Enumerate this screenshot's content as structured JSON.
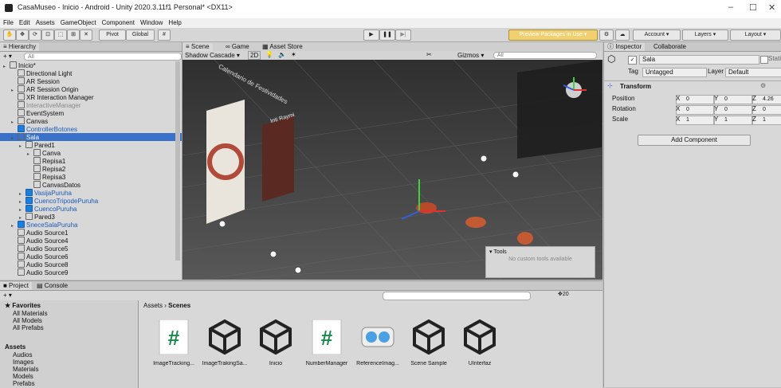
{
  "window": {
    "title": "CasaMuseo - Inicio - Android - Unity 2020.3.11f1 Personal* <DX11>",
    "min": "–",
    "max": "☐",
    "close": "✕"
  },
  "menu": [
    "File",
    "Edit",
    "Assets",
    "GameObject",
    "Component",
    "Window",
    "Help"
  ],
  "toolbar": {
    "pivot": "Pivot",
    "global": "Global",
    "preview": "Preview Packages in Use ▾",
    "account": "Account ▾",
    "layers": "Layers ▾",
    "layout": "Layout ▾"
  },
  "hierarchy": {
    "tab": "≡ Hierarchy",
    "search_placeholder": "All",
    "add": "+ ▾",
    "rows": [
      {
        "label": "Inicio*",
        "indent": 0
      },
      {
        "label": "Directional Light",
        "indent": 1
      },
      {
        "label": "AR Session",
        "indent": 1
      },
      {
        "label": "AR Session Origin",
        "indent": 1
      },
      {
        "label": "XR Interaction Manager",
        "indent": 1
      },
      {
        "label": "InteractiveManager",
        "indent": 1
      },
      {
        "label": "EventSystem",
        "indent": 1
      },
      {
        "label": "Canvas",
        "indent": 1
      },
      {
        "label": "ControllerBotones",
        "indent": 1
      },
      {
        "label": "Sala",
        "indent": 1
      },
      {
        "label": "Pared1",
        "indent": 2
      },
      {
        "label": "Canva",
        "indent": 3
      },
      {
        "label": "Repisa1",
        "indent": 3
      },
      {
        "label": "Repisa2",
        "indent": 3
      },
      {
        "label": "Repisa3",
        "indent": 3
      },
      {
        "label": "CanvasDatos",
        "indent": 3
      },
      {
        "label": "VasijaPuruha",
        "indent": 2
      },
      {
        "label": "CuencoTripodePuruha",
        "indent": 2
      },
      {
        "label": "CuencoPuruha",
        "indent": 2
      },
      {
        "label": "Pared3",
        "indent": 2
      },
      {
        "label": "SneceSalaPuruha",
        "indent": 1
      },
      {
        "label": "Audio Source1",
        "indent": 1
      },
      {
        "label": "Audio Source4",
        "indent": 1
      },
      {
        "label": "Audio Source5",
        "indent": 1
      },
      {
        "label": "Audio Source6",
        "indent": 1
      },
      {
        "label": "Audio Source8",
        "indent": 1
      },
      {
        "label": "Audio Source9",
        "indent": 1
      }
    ]
  },
  "scene": {
    "tabs": [
      "≡ Scene",
      "∞ Game",
      "▦ Asset Store"
    ],
    "shading": "Shadow Cascade ▾",
    "mode_2d": "2D",
    "gizmos": "Gizmos ▾",
    "search_placeholder": "All",
    "wall1_title": "Calendario de Festividades",
    "wall2_title": "Inti Raymi",
    "tools_title": "▾ Tools",
    "tools_text": "No custom tools available"
  },
  "inspector": {
    "tabs": [
      "ⓘ Inspector",
      "Collaborate"
    ],
    "name": "Sala",
    "static": "Static",
    "tag_label": "Tag",
    "tag": "Untagged",
    "layer_label": "Layer",
    "layer": "Default",
    "transform": "Transform",
    "position_label": "Position",
    "rotation_label": "Rotation",
    "scale_label": "Scale",
    "x": "X",
    "y": "Y",
    "z": "Z",
    "position": [
      "0",
      "0",
      "4.26"
    ],
    "rotation": [
      "0",
      "0",
      "0"
    ],
    "scale": [
      "1",
      "1",
      "1"
    ],
    "add_component": "Add Component"
  },
  "project": {
    "tabs": [
      "■ Project",
      "▤ Console"
    ],
    "add": "+ ▾",
    "count": "20",
    "favorites": "Favorites",
    "favorites_items": [
      "All Materials",
      "All Models",
      "All Prefabs"
    ],
    "assets_root": "Assets",
    "folders": [
      "Audios",
      "Images",
      "Materials",
      "Models",
      "Prefabs"
    ],
    "breadcrumb": [
      "Assets",
      "Scenes"
    ],
    "assets": [
      {
        "label": "ImageTracking...",
        "icon": "script-icon"
      },
      {
        "label": "ImageTrakingSa...",
        "icon": "unity-scene-icon"
      },
      {
        "label": "Inicio",
        "icon": "unity-scene-icon"
      },
      {
        "label": "NumberManager",
        "icon": "script-icon"
      },
      {
        "label": "ReferenceImag...",
        "icon": "reference-library-icon"
      },
      {
        "label": "Scene Sample",
        "icon": "unity-scene-icon"
      },
      {
        "label": "UInterfaz",
        "icon": "unity-scene-icon"
      }
    ]
  }
}
